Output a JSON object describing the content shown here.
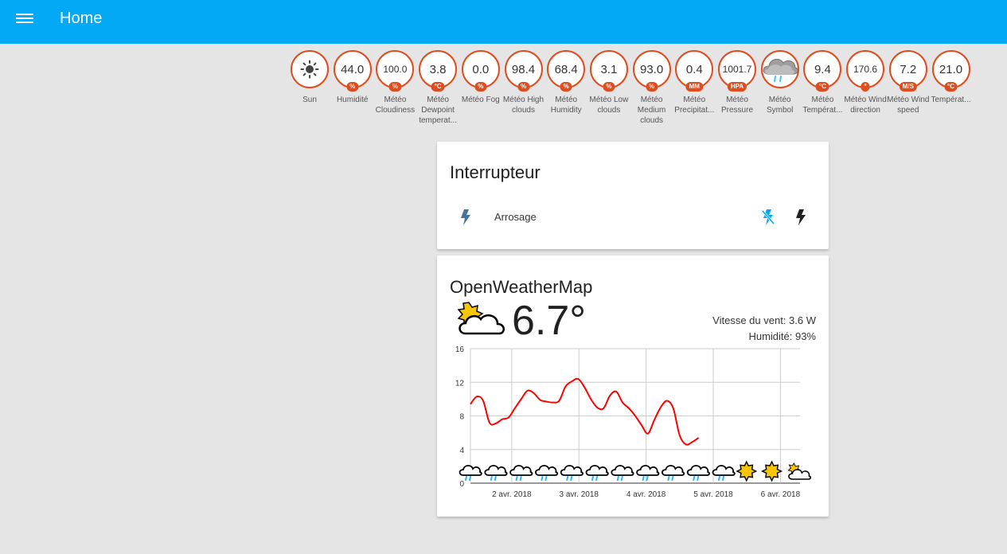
{
  "header": {
    "title": "Home"
  },
  "badges": [
    {
      "value": "",
      "unit": "",
      "label": "Sun",
      "icon": "sun-icon"
    },
    {
      "value": "44.0",
      "unit": "%",
      "label": "Humidité"
    },
    {
      "value": "100.0",
      "unit": "%",
      "label": "Météo Cloudiness"
    },
    {
      "value": "3.8",
      "unit": "°C",
      "label": "Météo Dewpoint temperat..."
    },
    {
      "value": "0.0",
      "unit": "%",
      "label": "Météo Fog"
    },
    {
      "value": "98.4",
      "unit": "%",
      "label": "Météo High clouds"
    },
    {
      "value": "68.4",
      "unit": "%",
      "label": "Météo Humidity"
    },
    {
      "value": "3.1",
      "unit": "%",
      "label": "Météo Low clouds"
    },
    {
      "value": "93.0",
      "unit": "%",
      "label": "Météo Medium clouds"
    },
    {
      "value": "0.4",
      "unit": "MM",
      "label": "Météo Precipitat..."
    },
    {
      "value": "1001.7",
      "unit": "HPA",
      "label": "Météo Pressure"
    },
    {
      "value": "",
      "unit": "",
      "label": "Météo Symbol",
      "icon": "rain-cloud-icon"
    },
    {
      "value": "9.4",
      "unit": "°C",
      "label": "Météo Températ..."
    },
    {
      "value": "170.6",
      "unit": "°",
      "label": "Météo Wind direction"
    },
    {
      "value": "7.2",
      "unit": "M/S",
      "label": "Météo Wind speed"
    },
    {
      "value": "21.0",
      "unit": "°C",
      "label": "Températ..."
    }
  ],
  "switch_card": {
    "title": "Interrupteur",
    "entity_label": "Arrosage",
    "entity_icon": "lightning-bolt-icon",
    "off_icon": "flash-off-icon",
    "on_icon": "flash-icon"
  },
  "weather_card": {
    "title": "OpenWeatherMap",
    "current_temp": "6.7°",
    "wind": "Vitesse du vent: 3.6 W",
    "humidity": "Humidité: 93%",
    "condition_icon": "partly-cloudy-icon"
  },
  "chart_data": {
    "type": "line",
    "x_ticks": [
      "2 avr. 2018",
      "3 avr. 2018",
      "4 avr. 2018",
      "5 avr. 2018",
      "6 avr. 2018"
    ],
    "ylim": [
      0,
      16
    ],
    "y_ticks": [
      0,
      4,
      8,
      12,
      16
    ],
    "grid": true,
    "series": [
      {
        "color": "#ff0000",
        "x": [
          0.0,
          0.25,
          0.5,
          0.75,
          1.0,
          1.25,
          1.5,
          1.75,
          2.0,
          2.25,
          2.5,
          2.75,
          3.0,
          3.25,
          3.5,
          3.75,
          4.0,
          4.25,
          4.5,
          4.75,
          5.0,
          5.25,
          5.5,
          5.75,
          6.0,
          6.25,
          6.5,
          6.75,
          7.0,
          7.25,
          7.5,
          7.75,
          8.0,
          8.25,
          8.5,
          8.75,
          9.0,
          9.25,
          9.5,
          9.75,
          10.0,
          10.25,
          10.5,
          10.75,
          11.0,
          11.25,
          11.5,
          11.75,
          12.0,
          12.25,
          12.5,
          12.75,
          13.0
        ],
        "values": [
          9.4,
          10.3,
          9.8,
          7.2,
          7.1,
          7.6,
          7.8,
          8.9,
          10.0,
          11.0,
          10.7,
          9.9,
          9.7,
          9.6,
          9.8,
          11.5,
          12.1,
          12.4,
          11.4,
          10.0,
          9.0,
          8.9,
          10.4,
          10.9,
          9.6,
          8.9,
          8.0,
          6.9,
          5.9,
          7.5,
          9.0,
          9.8,
          8.9,
          5.7,
          4.6,
          4.9,
          5.4,
          null,
          null,
          null,
          null,
          null,
          null,
          null,
          null,
          null,
          null,
          null,
          null,
          null,
          null,
          null,
          null
        ]
      }
    ],
    "forecast_icons": [
      "rain-cloud-icon",
      "rain-cloud-icon",
      "rain-cloud-icon",
      "rain-cloud-icon",
      "rain-cloud-icon",
      "rain-cloud-icon",
      "rain-cloud-icon",
      "rain-cloud-icon",
      "rain-cloud-icon",
      "rain-cloud-icon",
      "rain-cloud-icon",
      "sun-icon",
      "sun-icon",
      "partly-cloudy-icon"
    ]
  }
}
